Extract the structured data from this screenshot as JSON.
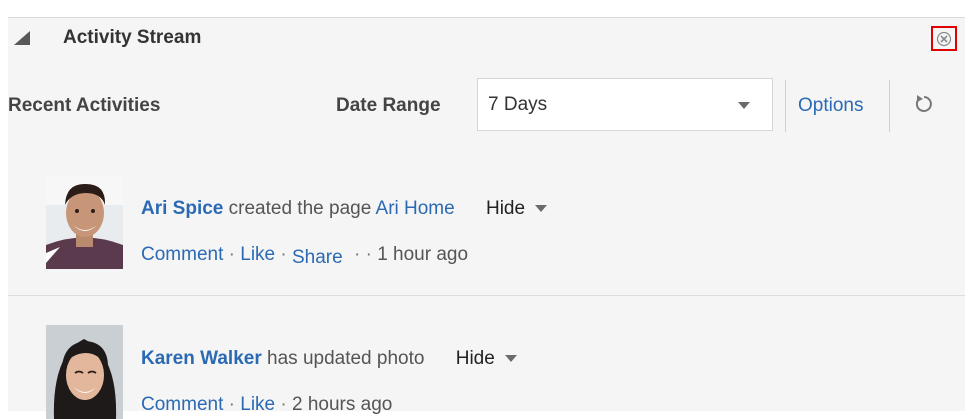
{
  "header": {
    "title": "Activity Stream"
  },
  "toolbar": {
    "recent_label": "Recent Activities",
    "date_range_label": "Date Range",
    "date_range_value": "7 Days",
    "options_label": "Options"
  },
  "activities": [
    {
      "user": "Ari Spice",
      "action": "created the page",
      "target": "Ari Home",
      "hide_label": "Hide",
      "comment": "Comment",
      "like": "Like",
      "share": "Share",
      "sep": "·",
      "time": "1 hour ago"
    },
    {
      "user": "Karen Walker",
      "action": "has updated photo",
      "hide_label": "Hide",
      "comment": "Comment",
      "like": "Like",
      "sep": "·",
      "time": "2 hours ago"
    }
  ],
  "colors": {
    "link": "#2b6ab3",
    "panel_bg": "#f5f5f5",
    "close_highlight": "#e00000"
  },
  "icons": {
    "collapse": "triangle-collapse-icon",
    "close": "close-icon",
    "dropdown": "chevron-down-icon",
    "refresh": "refresh-icon"
  }
}
